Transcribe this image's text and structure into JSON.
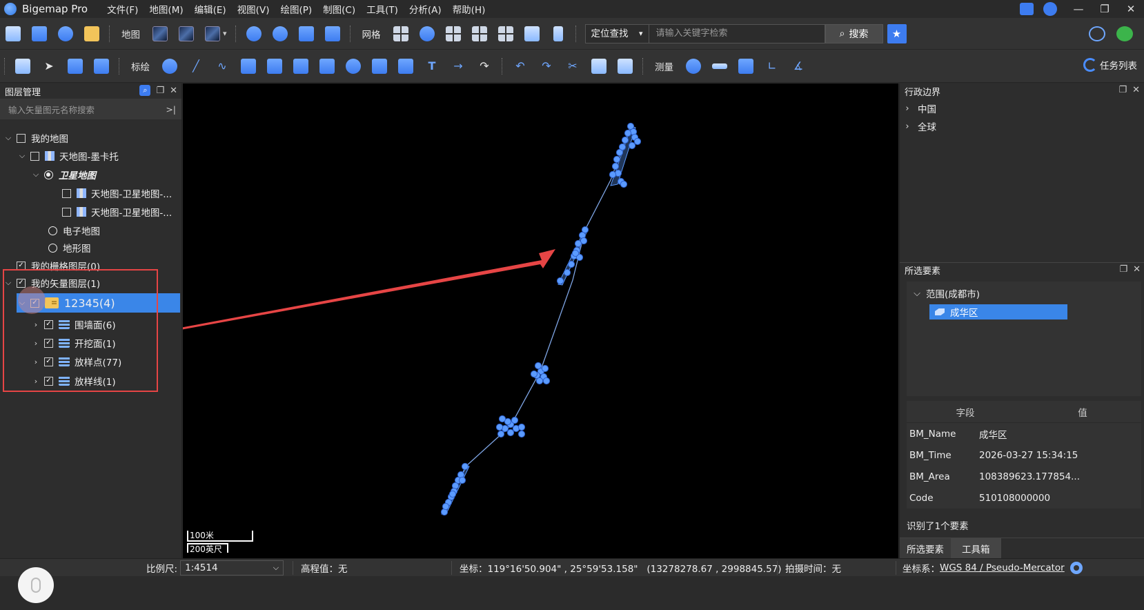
{
  "app": {
    "title": "Bigemap Pro"
  },
  "menu": [
    "文件(F)",
    "地图(M)",
    "编辑(E)",
    "视图(V)",
    "绘图(P)",
    "制图(C)",
    "工具(T)",
    "分析(A)",
    "帮助(H)"
  ],
  "window_controls": {
    "minimize": "—",
    "restore": "❐",
    "close": "✕"
  },
  "toolbar1": {
    "map_label": "地图",
    "grid_label": "网格",
    "search_mode": "定位查找",
    "search_placeholder": "请输入关键字检索",
    "search_button": "搜索"
  },
  "toolbar2": {
    "annotate_label": "标绘",
    "measure_label": "测量",
    "task_list": "任务列表"
  },
  "layer_panel": {
    "title": "图层管理",
    "filter_placeholder": "输入矢量图元名称搜索",
    "tree": {
      "my_map": "我的地图",
      "tianditu_mercator": "天地图-墨卡托",
      "satellite_map": "卫星地图",
      "sat_sub1": "天地图-卫星地图-...",
      "sat_sub2": "天地图-卫星地图-...",
      "electronic_map": "电子地图",
      "terrain_map": "地形图",
      "my_raster": "我的栅格图层(0)",
      "my_vector": "我的矢量图层(1)",
      "folder_12345": "12345(4)",
      "wall_surface": "围墙面(6)",
      "excavation_surface": "开挖面(1)",
      "stakeout_points": "放样点(77)",
      "stakeout_lines": "放样线(1)"
    }
  },
  "map": {
    "scale_bar": {
      "metric": "100米",
      "imperial": "200英尺"
    }
  },
  "admin_panel": {
    "title": "行政边界",
    "items": [
      "中国",
      "全球"
    ]
  },
  "selected_panel": {
    "title": "所选要素",
    "range": "范围(成都市)",
    "selected_item": "成华区",
    "table_headers": {
      "field": "字段",
      "value": "值"
    },
    "rows": [
      {
        "k": "BM_Name",
        "v": "成华区"
      },
      {
        "k": "BM_Time",
        "v": "2026-03-27 15:34:15"
      },
      {
        "k": "BM_Area",
        "v": "108389623.177854..."
      },
      {
        "k": "Code",
        "v": "510108000000"
      }
    ],
    "recognized": "识别了1个要素",
    "tabs": [
      "所选要素",
      "工具箱"
    ]
  },
  "statusbar": {
    "scale_label": "比例尺:",
    "scale_value": "1:4514",
    "elevation": "高程值：无",
    "coords": "坐标：119°16'50.904\" , 25°59'53.158\"   (13278278.67 , 2998845.57)",
    "capture_time": "拍摄时间：无",
    "crs_label": "坐标系：",
    "crs_value": "WGS 84 / Pseudo-Mercator"
  },
  "colors": {
    "accent": "#3a86e8",
    "annotation_red": "#e64545",
    "feature_blue": "#5b9bff"
  }
}
